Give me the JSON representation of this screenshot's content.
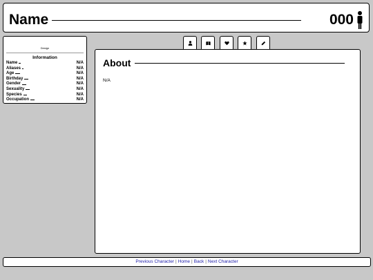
{
  "header": {
    "title": "Name",
    "number": "000",
    "icon": "person-icon"
  },
  "sidebar": {
    "design_text": "Design",
    "info_heading": "Information",
    "rows": [
      {
        "label": "Name",
        "value": "N/A"
      },
      {
        "label": "Aliases",
        "value": "N/A"
      },
      {
        "label": "Age",
        "value": "N/A"
      },
      {
        "label": "Birthday",
        "value": "N/A"
      },
      {
        "label": "Gender",
        "value": "N/A"
      },
      {
        "label": "Sexuality",
        "value": "N/A"
      },
      {
        "label": "Species",
        "value": "N/A"
      },
      {
        "label": "Occupation",
        "value": "N/A"
      }
    ]
  },
  "tabs": [
    {
      "icon": "person-icon"
    },
    {
      "icon": "book-icon"
    },
    {
      "icon": "heart-icon"
    },
    {
      "icon": "star-icon"
    },
    {
      "icon": "pencil-icon"
    }
  ],
  "main": {
    "section_title": "About",
    "text": "N/A"
  },
  "footer": {
    "previous": "Previous Character",
    "home": "Home",
    "back": "Back",
    "next": "Next Character",
    "separator": "|"
  }
}
